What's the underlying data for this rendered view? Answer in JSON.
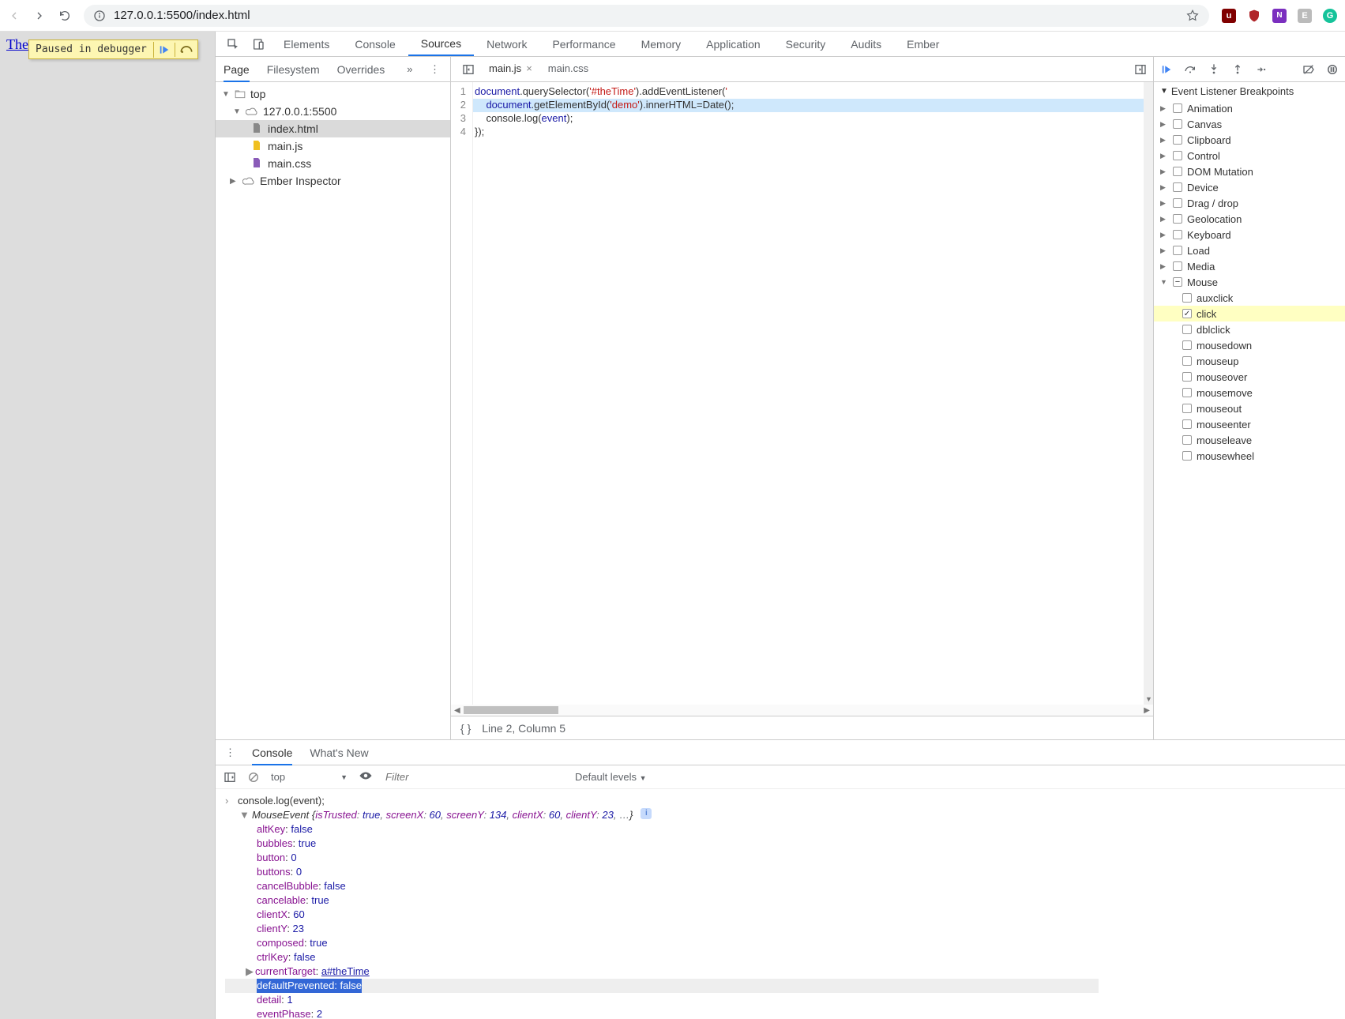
{
  "browser": {
    "url": "127.0.0.1:5500/index.html"
  },
  "page": {
    "link_text": "The",
    "debugger_msg": "Paused in debugger"
  },
  "devtools_tabs": [
    "Elements",
    "Console",
    "Sources",
    "Network",
    "Performance",
    "Memory",
    "Application",
    "Security",
    "Audits",
    "Ember"
  ],
  "devtools_active_tab": "Sources",
  "src_nav_tabs": [
    "Page",
    "Filesystem",
    "Overrides"
  ],
  "src_nav_active": "Page",
  "file_tree": {
    "root": "top",
    "host": "127.0.0.1:5500",
    "files": [
      "index.html",
      "main.js",
      "main.css"
    ],
    "selected": "index.html",
    "extra": "Ember Inspector"
  },
  "editor": {
    "tabs": [
      {
        "name": "main.js",
        "active": true,
        "closeable": true
      },
      {
        "name": "main.css",
        "active": false,
        "closeable": false
      }
    ],
    "code_plain": [
      "document.querySelector('#theTime').addEventListener('",
      "    document.getElementById('demo').innerHTML=Date();",
      "    console.log(event);",
      "});"
    ],
    "highlight_line": 2,
    "cursor_status": "Line 2, Column 5"
  },
  "breakpoints": {
    "section_title": "Event Listener Breakpoints",
    "categories": [
      {
        "name": "Animation",
        "expanded": false,
        "checked": false
      },
      {
        "name": "Canvas",
        "expanded": false,
        "checked": false
      },
      {
        "name": "Clipboard",
        "expanded": false,
        "checked": false
      },
      {
        "name": "Control",
        "expanded": false,
        "checked": false
      },
      {
        "name": "DOM Mutation",
        "expanded": false,
        "checked": false
      },
      {
        "name": "Device",
        "expanded": false,
        "checked": false
      },
      {
        "name": "Drag / drop",
        "expanded": false,
        "checked": false
      },
      {
        "name": "Geolocation",
        "expanded": false,
        "checked": false
      },
      {
        "name": "Keyboard",
        "expanded": false,
        "checked": false
      },
      {
        "name": "Load",
        "expanded": false,
        "checked": false
      },
      {
        "name": "Media",
        "expanded": false,
        "checked": false
      },
      {
        "name": "Mouse",
        "expanded": true,
        "checked": "mixed",
        "children": [
          {
            "name": "auxclick",
            "checked": false
          },
          {
            "name": "click",
            "checked": true,
            "highlight": true
          },
          {
            "name": "dblclick",
            "checked": false
          },
          {
            "name": "mousedown",
            "checked": false
          },
          {
            "name": "mouseup",
            "checked": false
          },
          {
            "name": "mouseover",
            "checked": false
          },
          {
            "name": "mousemove",
            "checked": false
          },
          {
            "name": "mouseout",
            "checked": false
          },
          {
            "name": "mouseenter",
            "checked": false
          },
          {
            "name": "mouseleave",
            "checked": false
          },
          {
            "name": "mousewheel",
            "checked": false
          }
        ]
      }
    ]
  },
  "drawer_tabs": [
    "Console",
    "What's New"
  ],
  "drawer_active": "Console",
  "console_toolbar": {
    "context": "top",
    "filter_placeholder": "Filter",
    "levels": "Default levels"
  },
  "console": {
    "call": "console.log(event);",
    "object_name": "MouseEvent",
    "preview_props": [
      {
        "k": "isTrusted",
        "v": "true",
        "t": "bool"
      },
      {
        "k": "screenX",
        "v": "60",
        "t": "num"
      },
      {
        "k": "screenY",
        "v": "134",
        "t": "num"
      },
      {
        "k": "clientX",
        "v": "60",
        "t": "num"
      },
      {
        "k": "clientY",
        "v": "23",
        "t": "num"
      }
    ],
    "expanded_props": [
      {
        "k": "altKey",
        "v": "false",
        "t": "bool"
      },
      {
        "k": "bubbles",
        "v": "true",
        "t": "bool"
      },
      {
        "k": "button",
        "v": "0",
        "t": "num"
      },
      {
        "k": "buttons",
        "v": "0",
        "t": "num"
      },
      {
        "k": "cancelBubble",
        "v": "false",
        "t": "bool"
      },
      {
        "k": "cancelable",
        "v": "true",
        "t": "bool"
      },
      {
        "k": "clientX",
        "v": "60",
        "t": "num"
      },
      {
        "k": "clientY",
        "v": "23",
        "t": "num"
      },
      {
        "k": "composed",
        "v": "true",
        "t": "bool"
      },
      {
        "k": "ctrlKey",
        "v": "false",
        "t": "bool"
      },
      {
        "k": "currentTarget",
        "v": "a#theTime",
        "t": "link",
        "caret": true
      },
      {
        "k": "defaultPrevented",
        "v": "false",
        "t": "bool",
        "selected": true
      },
      {
        "k": "detail",
        "v": "1",
        "t": "num"
      },
      {
        "k": "eventPhase",
        "v": "2",
        "t": "num"
      }
    ]
  }
}
